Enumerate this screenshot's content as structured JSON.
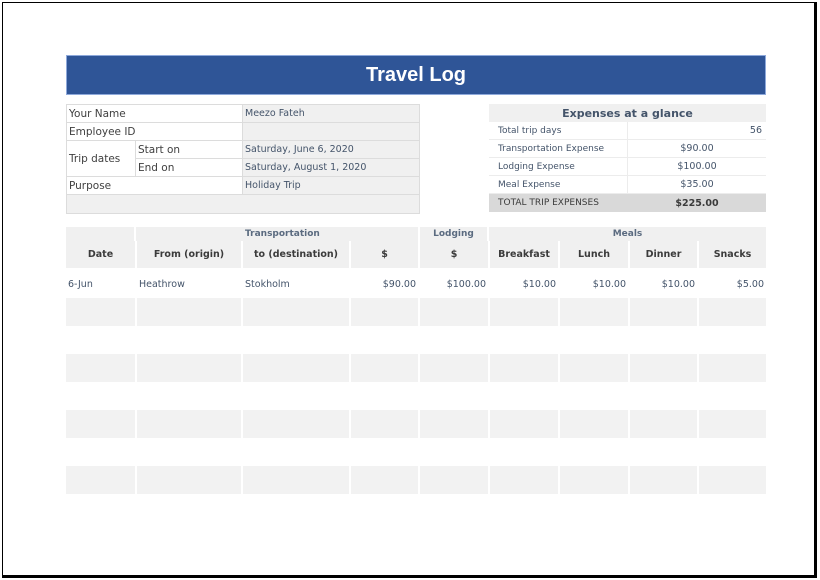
{
  "title": "Travel Log",
  "info": {
    "your_name_label": "Your Name",
    "your_name_value": "Meezo Fateh",
    "employee_id_label": "Employee ID",
    "employee_id_value": "",
    "trip_dates_label": "Trip dates",
    "start_on_label": "Start on",
    "start_on_value": "Saturday, June 6, 2020",
    "end_on_label": "End on",
    "end_on_value": "Saturday, August 1, 2020",
    "purpose_label": "Purpose",
    "purpose_value": "Holiday Trip"
  },
  "summary": {
    "title": "Expenses at a glance",
    "rows": [
      {
        "label": "Total trip days",
        "value": "56"
      },
      {
        "label": "Transportation Expense",
        "value": "$90.00"
      },
      {
        "label": "Lodging Expense",
        "value": "$100.00"
      },
      {
        "label": "Meal Expense",
        "value": "$35.00"
      }
    ],
    "total_label": "TOTAL TRIP EXPENSES",
    "total_value": "$225.00"
  },
  "log": {
    "groups": {
      "transportation": "Transportation",
      "lodging": "Lodging",
      "meals": "Meals"
    },
    "headers": [
      "Date",
      "From (origin)",
      "to (destination)",
      "$",
      "$",
      "Breakfast",
      "Lunch",
      "Dinner",
      "Snacks"
    ],
    "rows": [
      [
        "6-Jun",
        "Heathrow",
        "Stokholm",
        "$90.00",
        "$100.00",
        "$10.00",
        "$10.00",
        "$10.00",
        "$5.00"
      ],
      [
        "",
        "",
        "",
        "",
        "",
        "",
        "",
        "",
        ""
      ],
      [
        "",
        "",
        "",
        "",
        "",
        "",
        "",
        "",
        ""
      ],
      [
        "",
        "",
        "",
        "",
        "",
        "",
        "",
        "",
        ""
      ],
      [
        "",
        "",
        "",
        "",
        "",
        "",
        "",
        "",
        ""
      ],
      [
        "",
        "",
        "",
        "",
        "",
        "",
        "",
        "",
        ""
      ],
      [
        "",
        "",
        "",
        "",
        "",
        "",
        "",
        "",
        ""
      ],
      [
        "",
        "",
        "",
        "",
        "",
        "",
        "",
        "",
        ""
      ]
    ]
  }
}
